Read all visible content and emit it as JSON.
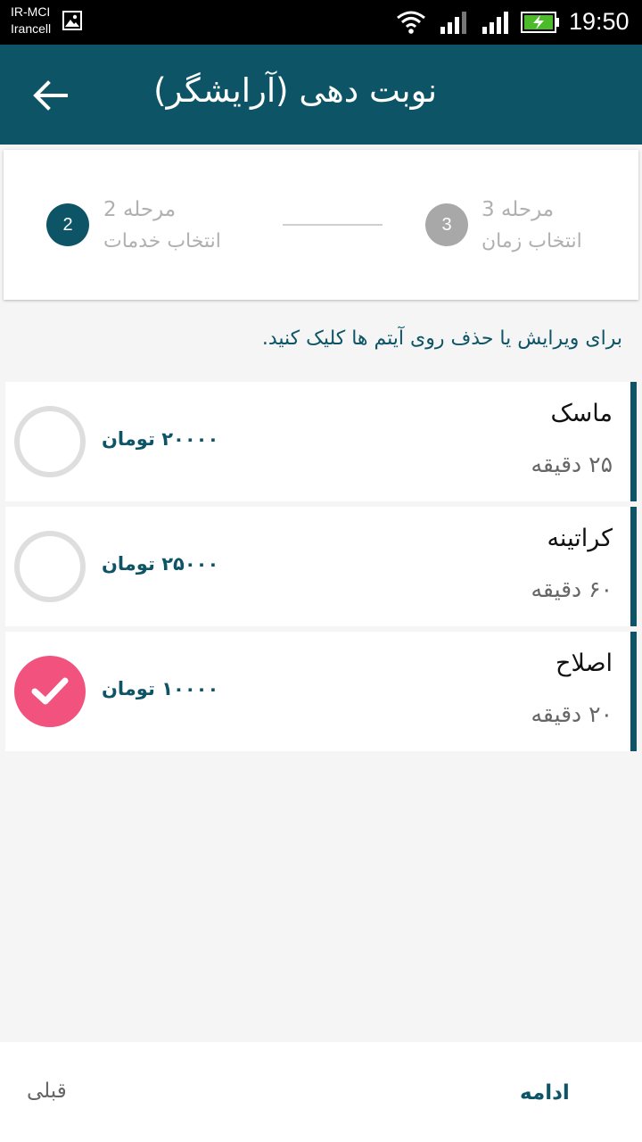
{
  "status_bar": {
    "carrier_line1": "IR-MCI",
    "carrier_line2": "Irancell",
    "time": "19:50"
  },
  "app_bar": {
    "title": "نوبت دهی (آرایشگر)",
    "back_icon": "arrow-back-icon"
  },
  "stepper": {
    "step2": {
      "number": "2",
      "title": "مرحله 2",
      "subtitle": "انتخاب خدمات"
    },
    "step3": {
      "number": "3",
      "title": "مرحله 3",
      "subtitle": "انتخاب زمان"
    }
  },
  "instruction": "برای ویرایش یا حذف روی آیتم ها کلیک کنید.",
  "items": [
    {
      "name": "ماسک",
      "duration": "۲۵ دقیقه",
      "price": "۲۰۰۰۰ تومان",
      "selected": false
    },
    {
      "name": "کراتینه",
      "duration": "۶۰ دقیقه",
      "price": "۲۵۰۰۰ تومان",
      "selected": false
    },
    {
      "name": "اصلاح",
      "duration": "۲۰ دقیقه",
      "price": "۱۰۰۰۰ تومان",
      "selected": true
    }
  ],
  "bottom_bar": {
    "prev_label": "قبلی",
    "next_label": "ادامه"
  },
  "colors": {
    "primary": "#0d5566",
    "accent": "#f2527e",
    "inactive_step": "#a8a8a8"
  }
}
